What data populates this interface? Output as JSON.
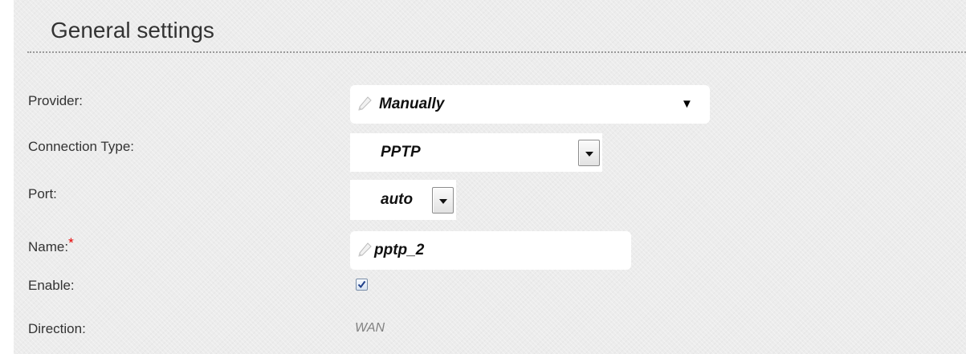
{
  "section": {
    "title": "General settings"
  },
  "fields": {
    "provider": {
      "label": "Provider:",
      "value": "Manually"
    },
    "connection_type": {
      "label": "Connection Type:",
      "value": "PPTP"
    },
    "port": {
      "label": "Port:",
      "value": "auto"
    },
    "name": {
      "label": "Name:",
      "required_mark": "*",
      "value": "pptp_2"
    },
    "enable": {
      "label": "Enable:",
      "checked": true
    },
    "direction": {
      "label": "Direction:",
      "value": "WAN"
    }
  },
  "icons": {
    "provider_edit": "pencil-icon",
    "name_edit": "pencil-icon",
    "provider_arrow": "triangle-down-icon",
    "select_arrow": "chevron-down-icon",
    "checkmark": "checkmark-icon"
  },
  "colors": {
    "panel_background": "#ececec",
    "required_star": "#e60000",
    "static_value": "#808080",
    "checkbox_check": "#1f3f8a"
  }
}
